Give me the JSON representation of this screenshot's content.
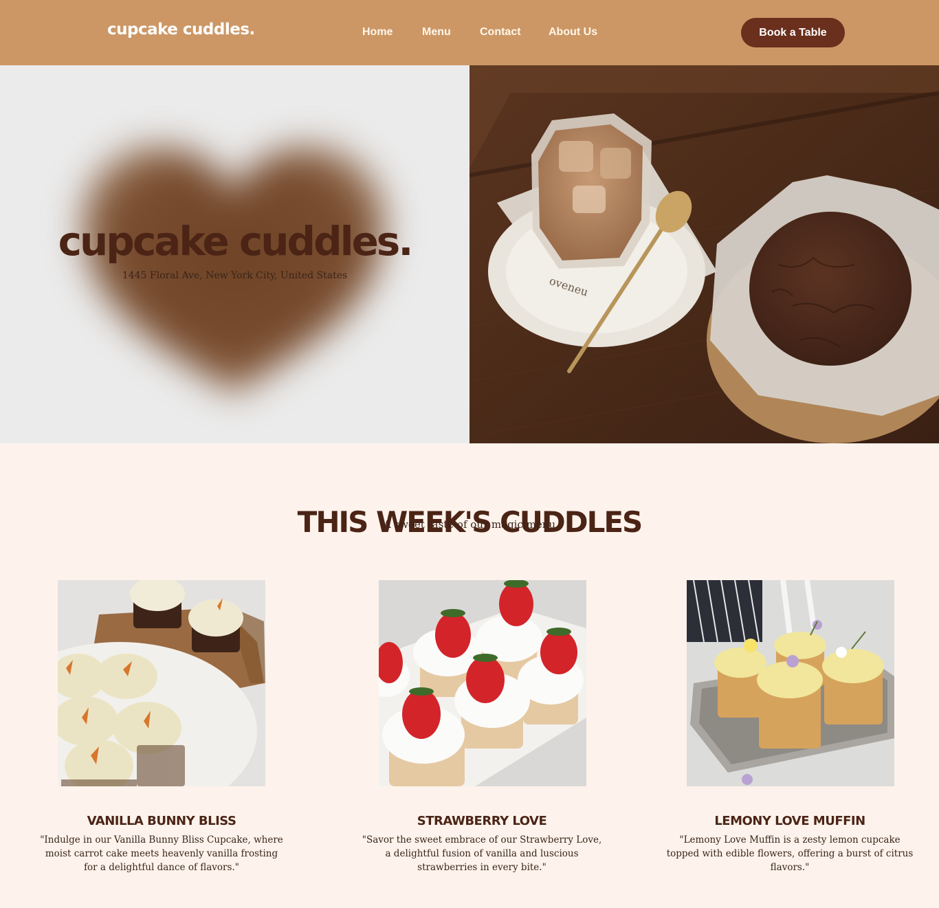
{
  "nav": {
    "logo": "cupcake cuddles.",
    "links": [
      "Home",
      "Menu",
      "Contact",
      "About Us"
    ],
    "cta": "Book a Table"
  },
  "hero": {
    "title": "cupcake cuddles.",
    "address": "1445 Floral Ave, New York City, United States",
    "napkin_text": "oveneu"
  },
  "menu": {
    "title": "THIS WEEK'S CUDDLES",
    "subtitle": "A sweet taste of our magic menu",
    "items": [
      {
        "name": "VANILLA BUNNY BLISS",
        "description": "\"Indulge in our Vanilla Bunny Bliss Cupcake, where moist carrot cake meets heavenly vanilla frosting for a delightful dance of flavors.\""
      },
      {
        "name": "STRAWBERRY LOVE",
        "description": "\"Savor the sweet embrace of our Strawberry Love, a delightful fusion of vanilla and luscious strawberries in every bite.\""
      },
      {
        "name": "LEMONY LOVE MUFFIN",
        "description": "\"Lemony Love Muffin is a zesty lemon cupcake topped with edible flowers, offering a burst of citrus flavors.\""
      }
    ]
  },
  "colors": {
    "nav_bg": "#cc9765",
    "button_bg": "#6a2f1d",
    "heading": "#4b2416",
    "page_bg": "#fdf3ec",
    "hero_left_bg": "#ebebeb"
  }
}
